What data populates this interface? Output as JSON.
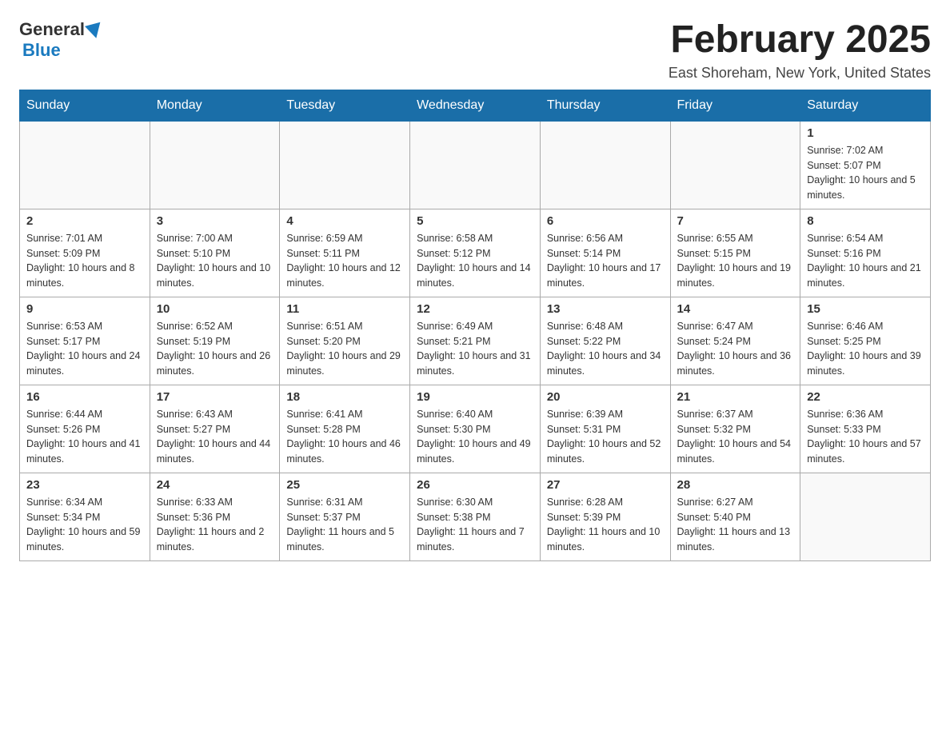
{
  "header": {
    "logo_general": "General",
    "logo_blue": "Blue",
    "month_title": "February 2025",
    "location": "East Shoreham, New York, United States"
  },
  "days_of_week": [
    "Sunday",
    "Monday",
    "Tuesday",
    "Wednesday",
    "Thursday",
    "Friday",
    "Saturday"
  ],
  "weeks": [
    [
      {
        "day": "",
        "info": ""
      },
      {
        "day": "",
        "info": ""
      },
      {
        "day": "",
        "info": ""
      },
      {
        "day": "",
        "info": ""
      },
      {
        "day": "",
        "info": ""
      },
      {
        "day": "",
        "info": ""
      },
      {
        "day": "1",
        "info": "Sunrise: 7:02 AM\nSunset: 5:07 PM\nDaylight: 10 hours and 5 minutes."
      }
    ],
    [
      {
        "day": "2",
        "info": "Sunrise: 7:01 AM\nSunset: 5:09 PM\nDaylight: 10 hours and 8 minutes."
      },
      {
        "day": "3",
        "info": "Sunrise: 7:00 AM\nSunset: 5:10 PM\nDaylight: 10 hours and 10 minutes."
      },
      {
        "day": "4",
        "info": "Sunrise: 6:59 AM\nSunset: 5:11 PM\nDaylight: 10 hours and 12 minutes."
      },
      {
        "day": "5",
        "info": "Sunrise: 6:58 AM\nSunset: 5:12 PM\nDaylight: 10 hours and 14 minutes."
      },
      {
        "day": "6",
        "info": "Sunrise: 6:56 AM\nSunset: 5:14 PM\nDaylight: 10 hours and 17 minutes."
      },
      {
        "day": "7",
        "info": "Sunrise: 6:55 AM\nSunset: 5:15 PM\nDaylight: 10 hours and 19 minutes."
      },
      {
        "day": "8",
        "info": "Sunrise: 6:54 AM\nSunset: 5:16 PM\nDaylight: 10 hours and 21 minutes."
      }
    ],
    [
      {
        "day": "9",
        "info": "Sunrise: 6:53 AM\nSunset: 5:17 PM\nDaylight: 10 hours and 24 minutes."
      },
      {
        "day": "10",
        "info": "Sunrise: 6:52 AM\nSunset: 5:19 PM\nDaylight: 10 hours and 26 minutes."
      },
      {
        "day": "11",
        "info": "Sunrise: 6:51 AM\nSunset: 5:20 PM\nDaylight: 10 hours and 29 minutes."
      },
      {
        "day": "12",
        "info": "Sunrise: 6:49 AM\nSunset: 5:21 PM\nDaylight: 10 hours and 31 minutes."
      },
      {
        "day": "13",
        "info": "Sunrise: 6:48 AM\nSunset: 5:22 PM\nDaylight: 10 hours and 34 minutes."
      },
      {
        "day": "14",
        "info": "Sunrise: 6:47 AM\nSunset: 5:24 PM\nDaylight: 10 hours and 36 minutes."
      },
      {
        "day": "15",
        "info": "Sunrise: 6:46 AM\nSunset: 5:25 PM\nDaylight: 10 hours and 39 minutes."
      }
    ],
    [
      {
        "day": "16",
        "info": "Sunrise: 6:44 AM\nSunset: 5:26 PM\nDaylight: 10 hours and 41 minutes."
      },
      {
        "day": "17",
        "info": "Sunrise: 6:43 AM\nSunset: 5:27 PM\nDaylight: 10 hours and 44 minutes."
      },
      {
        "day": "18",
        "info": "Sunrise: 6:41 AM\nSunset: 5:28 PM\nDaylight: 10 hours and 46 minutes."
      },
      {
        "day": "19",
        "info": "Sunrise: 6:40 AM\nSunset: 5:30 PM\nDaylight: 10 hours and 49 minutes."
      },
      {
        "day": "20",
        "info": "Sunrise: 6:39 AM\nSunset: 5:31 PM\nDaylight: 10 hours and 52 minutes."
      },
      {
        "day": "21",
        "info": "Sunrise: 6:37 AM\nSunset: 5:32 PM\nDaylight: 10 hours and 54 minutes."
      },
      {
        "day": "22",
        "info": "Sunrise: 6:36 AM\nSunset: 5:33 PM\nDaylight: 10 hours and 57 minutes."
      }
    ],
    [
      {
        "day": "23",
        "info": "Sunrise: 6:34 AM\nSunset: 5:34 PM\nDaylight: 10 hours and 59 minutes."
      },
      {
        "day": "24",
        "info": "Sunrise: 6:33 AM\nSunset: 5:36 PM\nDaylight: 11 hours and 2 minutes."
      },
      {
        "day": "25",
        "info": "Sunrise: 6:31 AM\nSunset: 5:37 PM\nDaylight: 11 hours and 5 minutes."
      },
      {
        "day": "26",
        "info": "Sunrise: 6:30 AM\nSunset: 5:38 PM\nDaylight: 11 hours and 7 minutes."
      },
      {
        "day": "27",
        "info": "Sunrise: 6:28 AM\nSunset: 5:39 PM\nDaylight: 11 hours and 10 minutes."
      },
      {
        "day": "28",
        "info": "Sunrise: 6:27 AM\nSunset: 5:40 PM\nDaylight: 11 hours and 13 minutes."
      },
      {
        "day": "",
        "info": ""
      }
    ]
  ]
}
